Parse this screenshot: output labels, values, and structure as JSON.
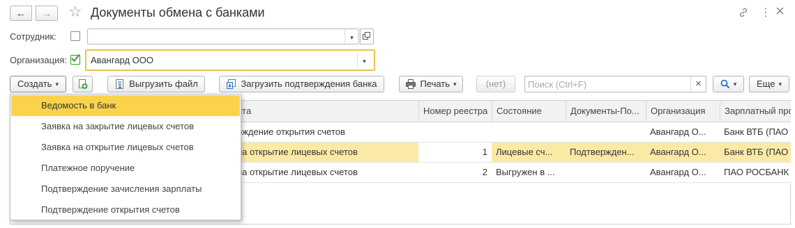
{
  "window": {
    "title": "Документы обмена с банками",
    "back_icon": "←",
    "forward_icon": "→",
    "star_icon": "☆",
    "link_icon": "🔗",
    "more_icon": "⋮",
    "close_icon": "×"
  },
  "filters": {
    "employee": {
      "label": "Сотрудник:",
      "value": "",
      "checked": false
    },
    "organization": {
      "label": "Организация:",
      "value": "Авангард ООО",
      "checked": true
    }
  },
  "toolbar": {
    "create_label": "Создать",
    "export_label": "Выгрузить файл",
    "import_label": "Загрузить подтверждения банка",
    "print_label": "Печать",
    "none_label": "(нет)",
    "search_placeholder": "Поиск (Ctrl+F)",
    "more_label": "Еще",
    "dropdown_caret": "▾",
    "clear_icon": "×",
    "search_icon": "🔍"
  },
  "create_menu": {
    "items": [
      {
        "label": "Ведомость в банк",
        "active": true
      },
      {
        "label": "Заявка на закрытие лицевых счетов",
        "active": false
      },
      {
        "label": "Заявка на открытие лицевых счетов",
        "active": false
      },
      {
        "label": "Платежное поручение",
        "active": false
      },
      {
        "label": "Подтверждение зачисления зарплаты",
        "active": false
      },
      {
        "label": "Подтверждение открытия счетов",
        "active": false
      }
    ]
  },
  "table": {
    "columns": [
      "нта",
      "Номер реестра",
      "Состояние",
      "Документы-По...",
      "Организация",
      "Зарплатный про"
    ],
    "rows": [
      {
        "doc": "рждение открытия счетов",
        "registry": "",
        "state": "",
        "docs": "",
        "org": "Авангард О...",
        "project": "Банк ВТБ (ПАО",
        "selected": false
      },
      {
        "doc": "на открытие лицевых счетов",
        "registry": "1",
        "state": "Лицевые сч...",
        "docs": "Подтвержден...",
        "org": "Авангард О...",
        "project": "Банк ВТБ (ПАО",
        "selected": true
      },
      {
        "doc": "на открытие лицевых счетов",
        "registry": "2",
        "state": "Выгружен в ...",
        "docs": "",
        "org": "Авангард О...",
        "project": "ПАО РОСБАНК",
        "selected": false
      }
    ]
  },
  "colors": {
    "highlight": "#fbd34b",
    "selected_row": "#fbeaa6",
    "focus_border": "#e9c24a",
    "check_green": "#2e9b2e",
    "accent_blue": "#2e6fc9"
  }
}
